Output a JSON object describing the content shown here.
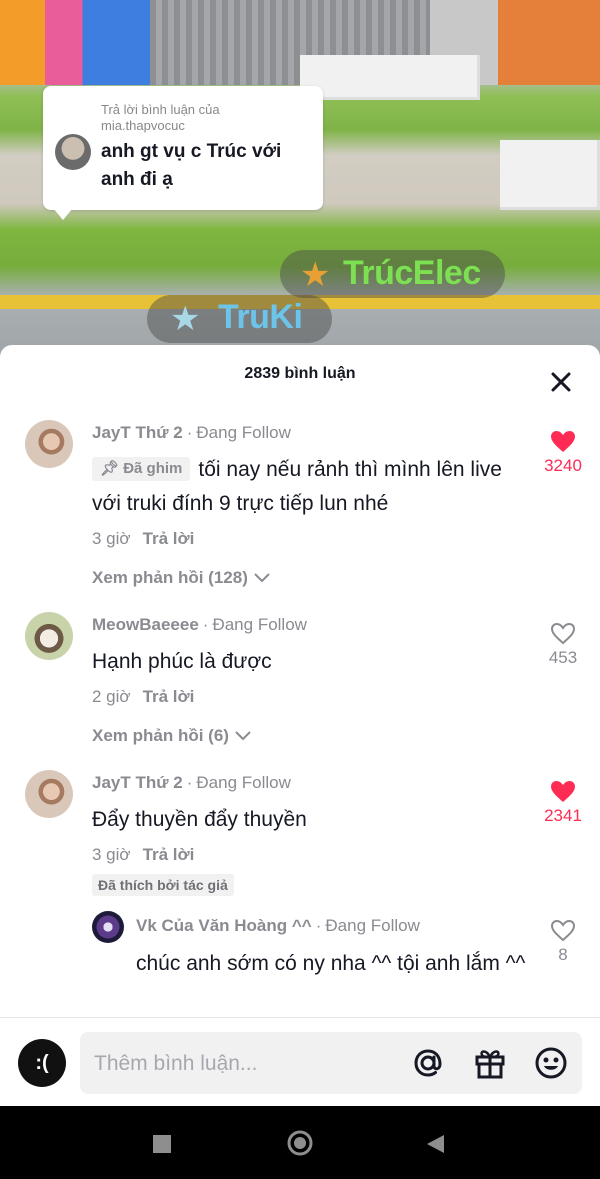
{
  "video": {
    "reply_card": {
      "reply_to_line1": "Trả lời bình luận của",
      "reply_to_line2": "mia.thapvocuc",
      "comment": "anh gt vụ c Trúc với anh đi ạ"
    },
    "tag_truki": "TruKi",
    "tag_trucelec": "TrúcElec"
  },
  "sheet": {
    "title": "2839 bình luận",
    "close_icon": "close-icon"
  },
  "comments": [
    {
      "user": "JayT Thứ 2",
      "follow_label": "Đang Follow",
      "pin_label": "Đã ghim",
      "text": "tối nay nếu rảnh thì mình lên live với truki đính 9 trực tiếp lun nhé",
      "time": "3 giờ",
      "reply_label": "Trả lời",
      "likes": "3240",
      "liked": true,
      "view_replies": "Xem phản hồi (128)"
    },
    {
      "user": "MeowBaeeee",
      "follow_label": "Đang Follow",
      "text": "Hạnh phúc là được",
      "time": "2 giờ",
      "reply_label": "Trả lời",
      "likes": "453",
      "liked": false,
      "view_replies": "Xem phản hồi (6)"
    },
    {
      "user": "JayT Thứ 2",
      "follow_label": "Đang Follow",
      "text": "Đẩy thuyền đẩy thuyền",
      "time": "3 giờ",
      "reply_label": "Trả lời",
      "likes": "2341",
      "liked": true,
      "liked_by_author": "Đã thích bởi tác giả"
    },
    {
      "user": "Vk Của Văn Hoàng ^^",
      "follow_label": "Đang Follow",
      "text": "chúc anh sớm có ny nha ^^ tội anh lắm ^^",
      "likes": "8",
      "liked": false
    }
  ],
  "input_bar": {
    "avatar_text": ":(",
    "placeholder": "Thêm bình luận...",
    "icons": [
      "at-icon",
      "gift-icon",
      "emoji-icon"
    ]
  },
  "colors": {
    "like_red": "#fe2c55",
    "muted": "#8a8b91",
    "text": "#161823"
  }
}
